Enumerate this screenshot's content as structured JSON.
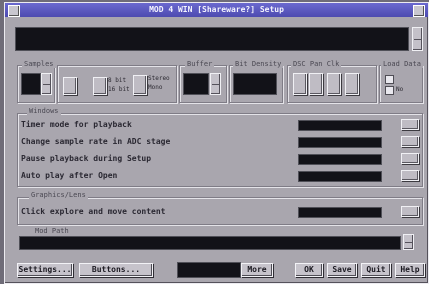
{
  "window": {
    "title": "MOD 4 WIN [Shareware?] Setup"
  },
  "groups": {
    "sample_rate": "Samples",
    "stereo": "",
    "buffer": "Buffer",
    "bit_depth": "Bit Density",
    "chan_flags": "DSC  Pan  Clk",
    "load_data": "Load Data",
    "playback": "Windows",
    "graphics": "Graphics/Lens",
    "default_path": "Mod Path"
  },
  "stereo": {
    "opt_a": "Stereo",
    "opt_b": "Mono",
    "sel_a": "8 bit",
    "sel_b": "16 bit"
  },
  "load_data": {
    "label_a": "No"
  },
  "options": [
    {
      "label": "Timer mode for playback"
    },
    {
      "label": "Change sample rate in ADC stage"
    },
    {
      "label": "Pause playback during Setup"
    },
    {
      "label": "Auto play after Open"
    },
    {
      "label": "Click explore and move content"
    }
  ],
  "buttons": {
    "settings": "Settings...",
    "buttons": "Buttons...",
    "more": "More",
    "ok": "OK",
    "save": "Save",
    "quit": "Quit",
    "help": "Help"
  },
  "colors": {
    "title_bar": "#5553c0",
    "window_bg": "#a9a6ae",
    "field_dark": "#121218",
    "desk_bg": "#6f6c78"
  }
}
